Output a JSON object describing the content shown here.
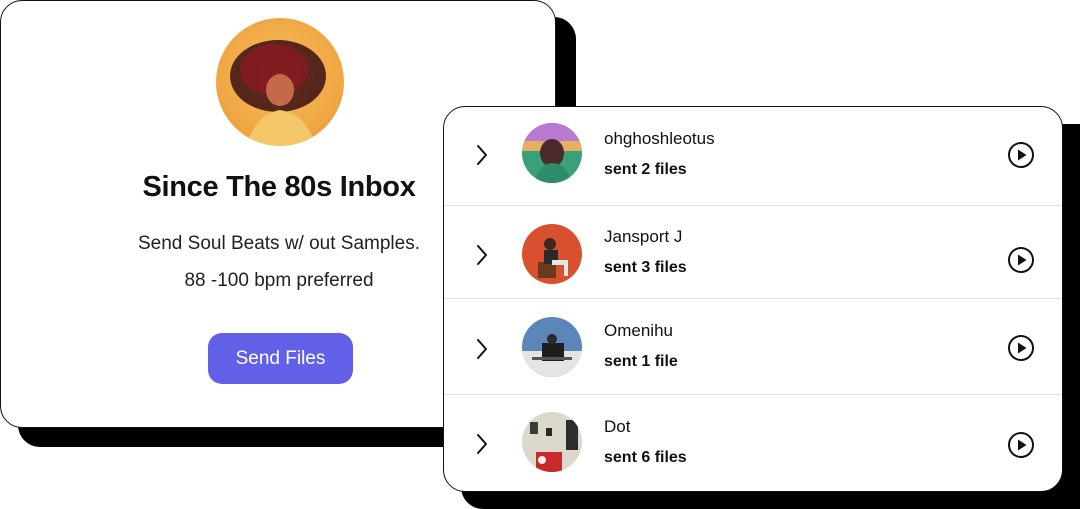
{
  "inbox": {
    "title": "Since The 80s Inbox",
    "description_line1": "Send Soul Beats w/ out Samples.",
    "description_line2": "88 -100 bpm preferred",
    "send_button_label": "Send Files",
    "button_color": "#6360e8"
  },
  "senders": [
    {
      "name": "ohghoshleotus",
      "files_label": "sent 2 files",
      "expand_icon": "chevron-right-icon",
      "play_icon": "play-circle-icon"
    },
    {
      "name": "Jansport J",
      "files_label": "sent 3 files",
      "expand_icon": "chevron-right-icon",
      "play_icon": "play-circle-icon"
    },
    {
      "name": "Omenihu",
      "files_label": "sent 1 file",
      "expand_icon": "chevron-right-icon",
      "play_icon": "play-circle-icon"
    },
    {
      "name": "Dot",
      "files_label": "sent 6 files",
      "expand_icon": "chevron-right-icon",
      "play_icon": "play-circle-icon"
    }
  ]
}
